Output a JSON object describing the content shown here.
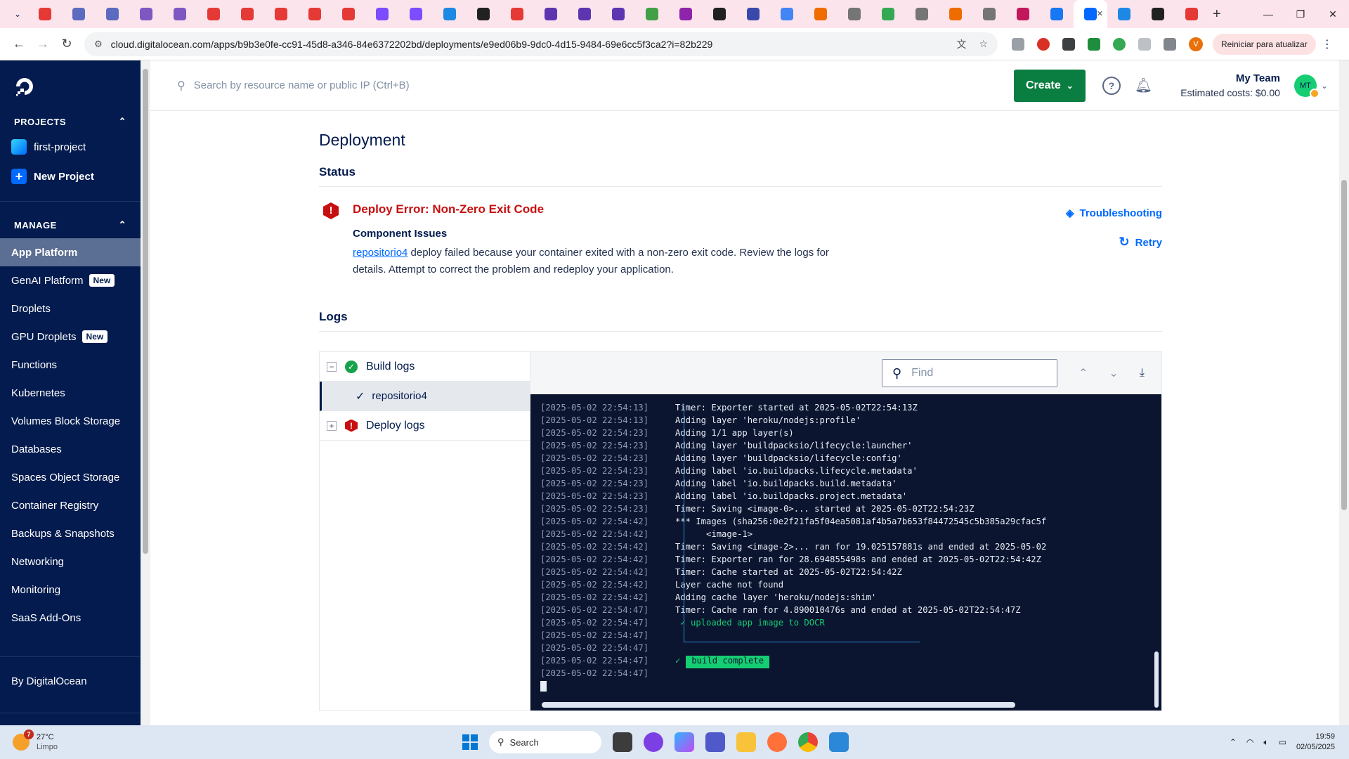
{
  "browser": {
    "url": "cloud.digitalocean.com/apps/b9b3e0fe-cc91-45d8-a346-84e6372202bd/deployments/e9ed06b9-9dc0-4d15-9484-69e6cc5f3ca2?i=82b229",
    "update_button": "Reiniciar para atualizar",
    "profile_initial": "V",
    "tab_favicon_colors": [
      "#e53935",
      "#5c6bc0",
      "#5c6bc0",
      "#7e57c2",
      "#7e57c2",
      "#e53935",
      "#e53935",
      "#e53935",
      "#e53935",
      "#e53935",
      "#7c4dff",
      "#7c4dff",
      "#1e88e5",
      "#212121",
      "#e53935",
      "#5e35b1",
      "#5e35b1",
      "#5e35b1",
      "#43a047",
      "#8e24aa",
      "#212121",
      "#3949ab",
      "#4285f4",
      "#ef6c00",
      "#757575",
      "#34a853",
      "#757575",
      "#ef6c00",
      "#757575",
      "#c2185b",
      "#1877f2",
      "#0069ff",
      "#1e88e5",
      "#212121",
      "#e53935"
    ]
  },
  "topbar": {
    "search_placeholder": "Search by resource name or public IP (Ctrl+B)",
    "create_label": "Create",
    "help_icon": "question-circle-icon",
    "team_name": "My Team",
    "estimated_costs": "Estimated costs: $0.00",
    "avatar_initials": "MT"
  },
  "sidebar": {
    "projects_label": "PROJECTS",
    "projects": [
      {
        "label": "first-project"
      },
      {
        "label": "New Project"
      }
    ],
    "manage_label": "MANAGE",
    "items": [
      {
        "label": "App Platform",
        "active": true
      },
      {
        "label": "GenAI Platform",
        "badge": "New"
      },
      {
        "label": "Droplets"
      },
      {
        "label": "GPU Droplets",
        "badge": "New"
      },
      {
        "label": "Functions"
      },
      {
        "label": "Kubernetes"
      },
      {
        "label": "Volumes Block Storage"
      },
      {
        "label": "Databases"
      },
      {
        "label": "Spaces Object Storage"
      },
      {
        "label": "Container Registry"
      },
      {
        "label": "Backups & Snapshots"
      },
      {
        "label": "Networking"
      },
      {
        "label": "Monitoring"
      },
      {
        "label": "SaaS Add-Ons"
      }
    ],
    "by_label": "By DigitalOcean"
  },
  "deployment": {
    "title": "Deployment",
    "status_heading": "Status",
    "error_title": "Deploy Error: Non-Zero Exit Code",
    "component_issues": "Component Issues",
    "component_link": "repositorio4",
    "issue_text": " deploy failed because your container exited with a non-zero exit code. Review the logs for details. Attempt to correct the problem and redeploy your application.",
    "troubleshooting": "Troubleshooting",
    "retry": "Retry",
    "logs_heading": "Logs"
  },
  "logs": {
    "build_logs": "Build logs",
    "component": "repositorio4",
    "deploy_logs": "Deploy logs",
    "find_placeholder": "Find",
    "lines": [
      {
        "ts": "[2025-05-02 22:54:13]",
        "msg": "Timer: Exporter started at 2025-05-02T22:54:13Z"
      },
      {
        "ts": "[2025-05-02 22:54:13]",
        "msg": "Adding layer 'heroku/nodejs:profile'"
      },
      {
        "ts": "[2025-05-02 22:54:23]",
        "msg": "Adding 1/1 app layer(s)"
      },
      {
        "ts": "[2025-05-02 22:54:23]",
        "msg": "Adding layer 'buildpacksio/lifecycle:launcher'"
      },
      {
        "ts": "[2025-05-02 22:54:23]",
        "msg": "Adding layer 'buildpacksio/lifecycle:config'"
      },
      {
        "ts": "[2025-05-02 22:54:23]",
        "msg": "Adding label 'io.buildpacks.lifecycle.metadata'"
      },
      {
        "ts": "[2025-05-02 22:54:23]",
        "msg": "Adding label 'io.buildpacks.build.metadata'"
      },
      {
        "ts": "[2025-05-02 22:54:23]",
        "msg": "Adding label 'io.buildpacks.project.metadata'"
      },
      {
        "ts": "[2025-05-02 22:54:23]",
        "msg": "Timer: Saving <image-0>... started at 2025-05-02T22:54:23Z"
      },
      {
        "ts": "[2025-05-02 22:54:42]",
        "msg": "*** Images (sha256:0e2f21fa5f04ea5081af4b5a7b653f84472545c5b385a29cfac5f"
      },
      {
        "ts": "[2025-05-02 22:54:42]",
        "msg": "      <image-1>"
      },
      {
        "ts": "[2025-05-02 22:54:42]",
        "msg": "Timer: Saving <image-2>... ran for 19.025157881s and ended at 2025-05-02"
      },
      {
        "ts": "[2025-05-02 22:54:42]",
        "msg": "Timer: Exporter ran for 28.694855498s and ended at 2025-05-02T22:54:42Z"
      },
      {
        "ts": "[2025-05-02 22:54:42]",
        "msg": "Timer: Cache started at 2025-05-02T22:54:42Z"
      },
      {
        "ts": "[2025-05-02 22:54:42]",
        "msg": "Layer cache not found"
      },
      {
        "ts": "[2025-05-02 22:54:42]",
        "msg": "Adding cache layer 'heroku/nodejs:shim'"
      },
      {
        "ts": "[2025-05-02 22:54:47]",
        "msg": "Timer: Cache ran for 4.890010476s and ended at 2025-05-02T22:54:47Z"
      },
      {
        "ts": "[2025-05-02 22:54:47]",
        "msg": " ✓ uploaded app image to DOCR",
        "green": true
      },
      {
        "ts": "[2025-05-02 22:54:47]",
        "msg": ""
      },
      {
        "ts": "[2025-05-02 22:54:47]",
        "msg": ""
      },
      {
        "ts": "[2025-05-02 22:54:47]",
        "msg": "✓",
        "complete": "build complete",
        "green": true
      },
      {
        "ts": "[2025-05-02 22:54:47]",
        "msg": ""
      }
    ]
  },
  "taskbar": {
    "temp": "27°C",
    "condition": "Limpo",
    "weather_badge": "7",
    "search": "Search",
    "time": "19:59",
    "date": "02/05/2025"
  },
  "colors": {
    "sidebar_bg": "#031b4e",
    "create_green": "#0a7d41",
    "error_red": "#c80f0f",
    "link_blue": "#0069ff",
    "terminal_bg": "#0b1530",
    "success_green": "#15cd72"
  }
}
